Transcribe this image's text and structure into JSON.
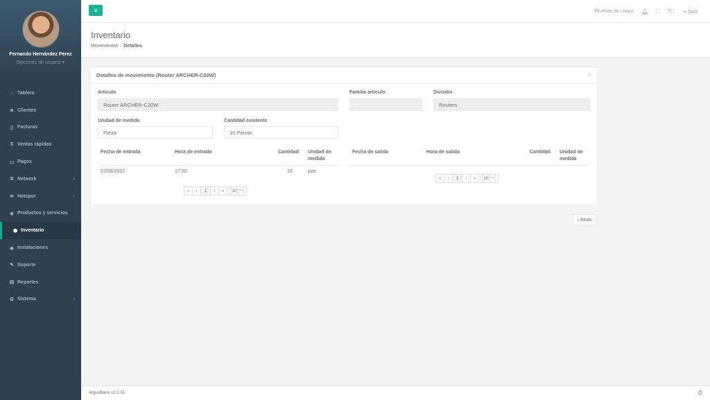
{
  "user": {
    "name": "Fernando Hernández Perez",
    "options_label": "Opciones de usuario ▾"
  },
  "nav": [
    {
      "icon": "tachometer-icon",
      "glyph": "⌂",
      "label": "Tablero",
      "has_chevron": false
    },
    {
      "icon": "users-icon",
      "glyph": "☻",
      "label": "Clientes",
      "has_chevron": false
    },
    {
      "icon": "file-icon",
      "glyph": "▯",
      "label": "Facturas",
      "has_chevron": false
    },
    {
      "icon": "dollar-icon",
      "glyph": "$",
      "label": "Ventas rápidas",
      "has_chevron": false
    },
    {
      "icon": "money-icon",
      "glyph": "▭",
      "label": "Pagos",
      "has_chevron": false
    },
    {
      "icon": "network-icon",
      "glyph": "✲",
      "label": "Network",
      "has_chevron": true
    },
    {
      "icon": "wifi-icon",
      "glyph": "≋",
      "label": "Hotspot",
      "has_chevron": true
    },
    {
      "icon": "tags-icon",
      "glyph": "◈",
      "label": "Productos y servicios",
      "has_chevron": false
    },
    {
      "icon": "cubes-icon",
      "glyph": "⬢",
      "label": "Inventario",
      "has_chevron": false,
      "active": true
    },
    {
      "icon": "wrench-icon",
      "glyph": "◆",
      "label": "Instalaciones",
      "has_chevron": false
    },
    {
      "icon": "tool-icon",
      "glyph": "✎",
      "label": "Soporte",
      "has_chevron": false
    },
    {
      "icon": "book-icon",
      "glyph": "▤",
      "label": "Reportes",
      "has_chevron": false
    },
    {
      "icon": "cogs-icon",
      "glyph": "⚙",
      "label": "Sistema",
      "has_chevron": true
    }
  ],
  "topbar": {
    "company": "Pruebas de Livaur",
    "logout": "Salir"
  },
  "page": {
    "title": "Inventario",
    "breadcrumb_parent": "Movimientos",
    "breadcrumb_current": "Detalles"
  },
  "panel": {
    "title": "Detalles de movimiento (Router ARCHER-C20W)",
    "close": "×",
    "fields": {
      "articulo_label": "Articulo",
      "articulo_value": "Router ARCHER-C20W",
      "familia_label": "Familia artículo",
      "familia_value": "",
      "division_label": "División",
      "division_value": "Routers",
      "unidad_label": "Unidad de medida",
      "unidad_value": "Pieza",
      "cantidad_label": "Cantidad existente",
      "cantidad_value": "10 Piezas"
    },
    "entradas": {
      "headers": [
        "Fecha de entrada",
        "Hora de entrada",
        "Cantidad",
        "Unidad de medida"
      ],
      "rows": [
        {
          "fecha": "07/06/2022",
          "hora": "17:20",
          "cantidad": "10",
          "unidad": "pza"
        }
      ],
      "page": "1",
      "page_size": "10"
    },
    "salidas": {
      "headers": [
        "Fecha de salida",
        "Hora de salida",
        "Cantidad",
        "Unidad de medida"
      ],
      "rows": [],
      "page": "1",
      "page_size": "10"
    }
  },
  "pager_glyphs": {
    "first": "«",
    "prev": "‹",
    "next": "›",
    "last": "»",
    "caret": "﹀"
  },
  "back_button": "‹ Atras",
  "footer": {
    "version": "ArgusBlack v2.3.16"
  }
}
